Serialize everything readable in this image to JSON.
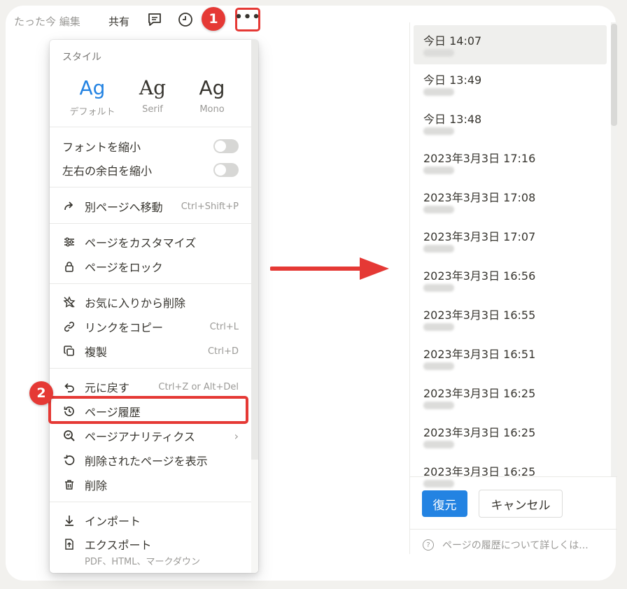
{
  "topbar": {
    "edited": "たった今 編集",
    "share": "共有",
    "more": "•••"
  },
  "badges": {
    "step1": "1",
    "step2": "2"
  },
  "menu": {
    "style_heading": "スタイル",
    "fonts": [
      {
        "sample": "Ag",
        "label": "デフォルト"
      },
      {
        "sample": "Ag",
        "label": "Serif"
      },
      {
        "sample": "Ag",
        "label": "Mono"
      }
    ],
    "small_text": "フォントを縮小",
    "full_width": "左右の余白を縮小",
    "move_to": {
      "label": "別ページへ移動",
      "shortcut": "Ctrl+Shift+P"
    },
    "customize": "ページをカスタマイズ",
    "lock": "ページをロック",
    "unfavorite": "お気に入りから削除",
    "copy_link": {
      "label": "リンクをコピー",
      "shortcut": "Ctrl+L"
    },
    "duplicate": {
      "label": "複製",
      "shortcut": "Ctrl+D"
    },
    "undo": {
      "label": "元に戻す",
      "shortcut": "Ctrl+Z or Alt+Del"
    },
    "page_history": "ページ履歴",
    "analytics": "ページアナリティクス",
    "show_deleted": "削除されたページを表示",
    "delete": "削除",
    "import": "インポート",
    "export": "エクスポート",
    "export_sub": "PDF、HTML、マークダウン"
  },
  "history": {
    "items": [
      "今日 14:07",
      "今日 13:49",
      "今日 13:48",
      "2023年3月3日 17:16",
      "2023年3月3日 17:08",
      "2023年3月3日 17:07",
      "2023年3月3日 16:56",
      "2023年3月3日 16:55",
      "2023年3月3日 16:51",
      "2023年3月3日 16:25",
      "2023年3月3日 16:25",
      "2023年3月3日 16:25"
    ],
    "selected_index": 0,
    "restore": "復元",
    "cancel": "キャンセル",
    "help": "ページの履歴について詳しくは..."
  },
  "colors": {
    "accent": "#2383e2",
    "annotation": "#e53935",
    "text": "#37352f",
    "muted": "#9b9a97"
  }
}
